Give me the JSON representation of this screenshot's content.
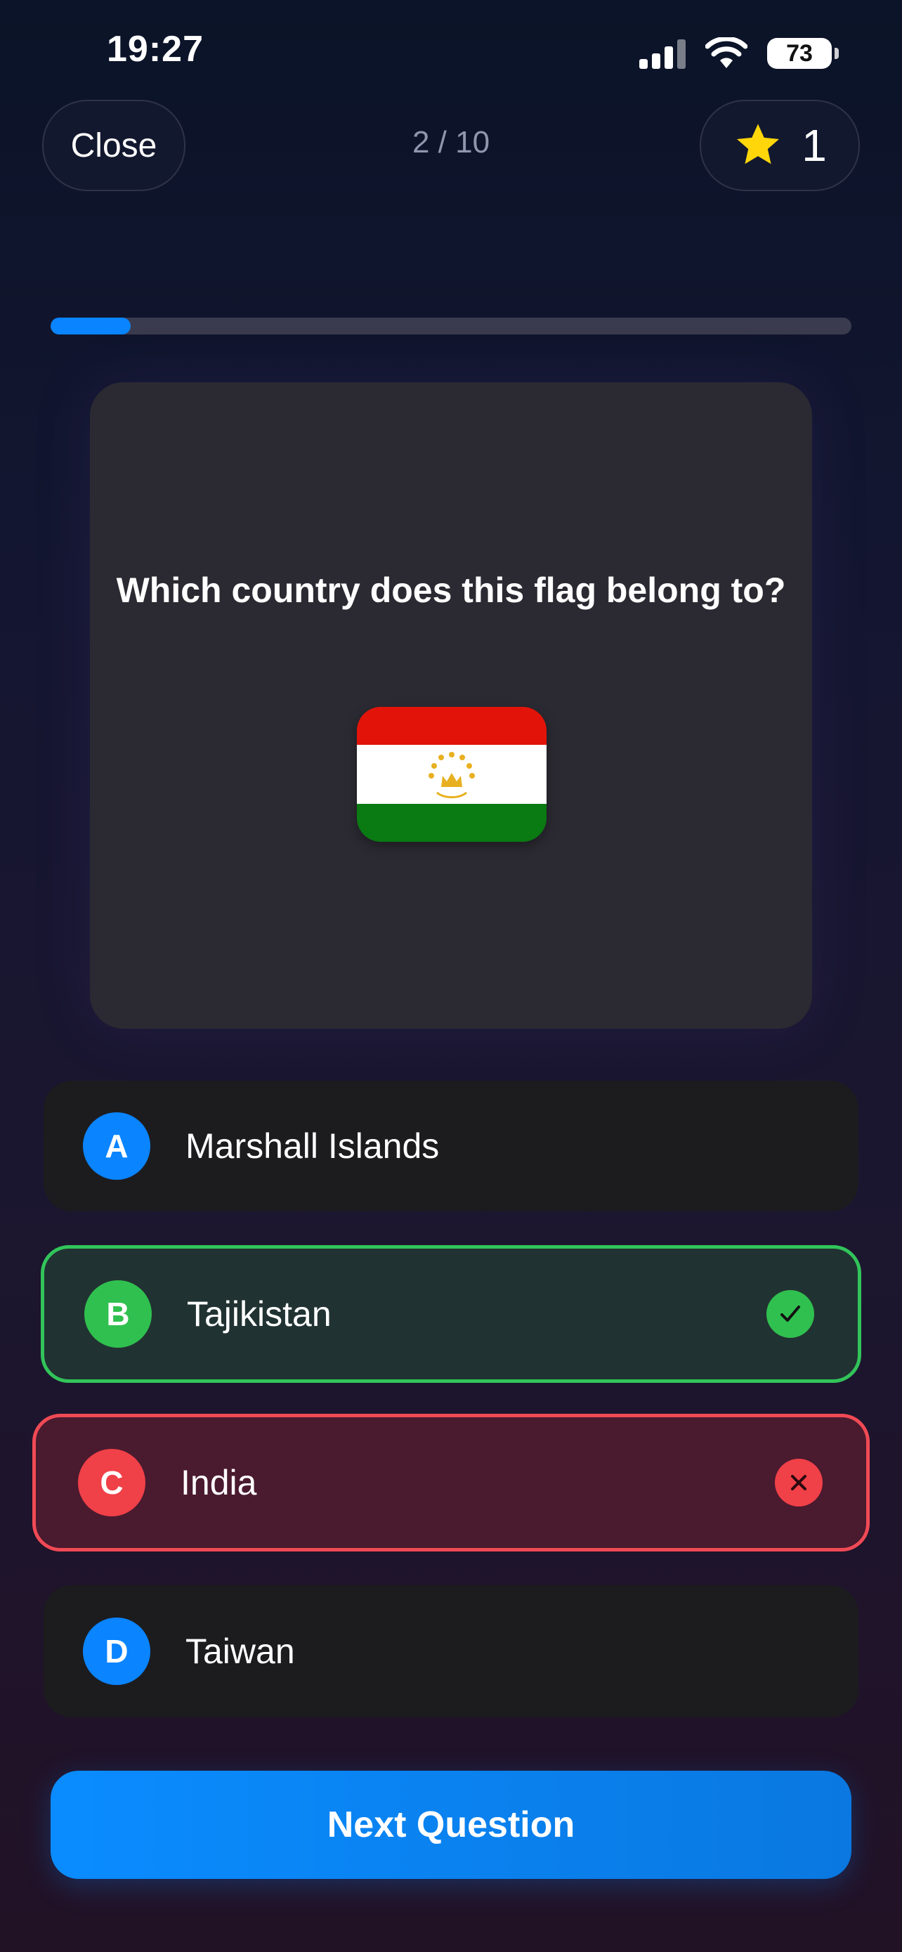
{
  "status_bar": {
    "time": "19:27",
    "battery": "73"
  },
  "header": {
    "close_label": "Close",
    "counter": "2 / 10",
    "score": "1"
  },
  "progress": {
    "fraction": 0.1
  },
  "question": {
    "text": "Which country does this flag belong to?"
  },
  "options": [
    {
      "letter": "A",
      "label": "Marshall Islands",
      "state": "default"
    },
    {
      "letter": "B",
      "label": "Tajikistan",
      "state": "correct"
    },
    {
      "letter": "C",
      "label": "India",
      "state": "wrong"
    },
    {
      "letter": "D",
      "label": "Taiwan",
      "state": "default"
    }
  ],
  "next_button": {
    "label": "Next Question"
  },
  "colors": {
    "accent": "#0a84ff",
    "correct": "#32c45a",
    "wrong": "#f04a55",
    "star": "#ffd60a"
  },
  "icons": {
    "star": "star-icon",
    "correct": "checkmark-icon",
    "wrong": "x-mark-icon",
    "wifi": "wifi-icon",
    "signal": "cellular-signal-icon",
    "battery": "battery-icon"
  }
}
